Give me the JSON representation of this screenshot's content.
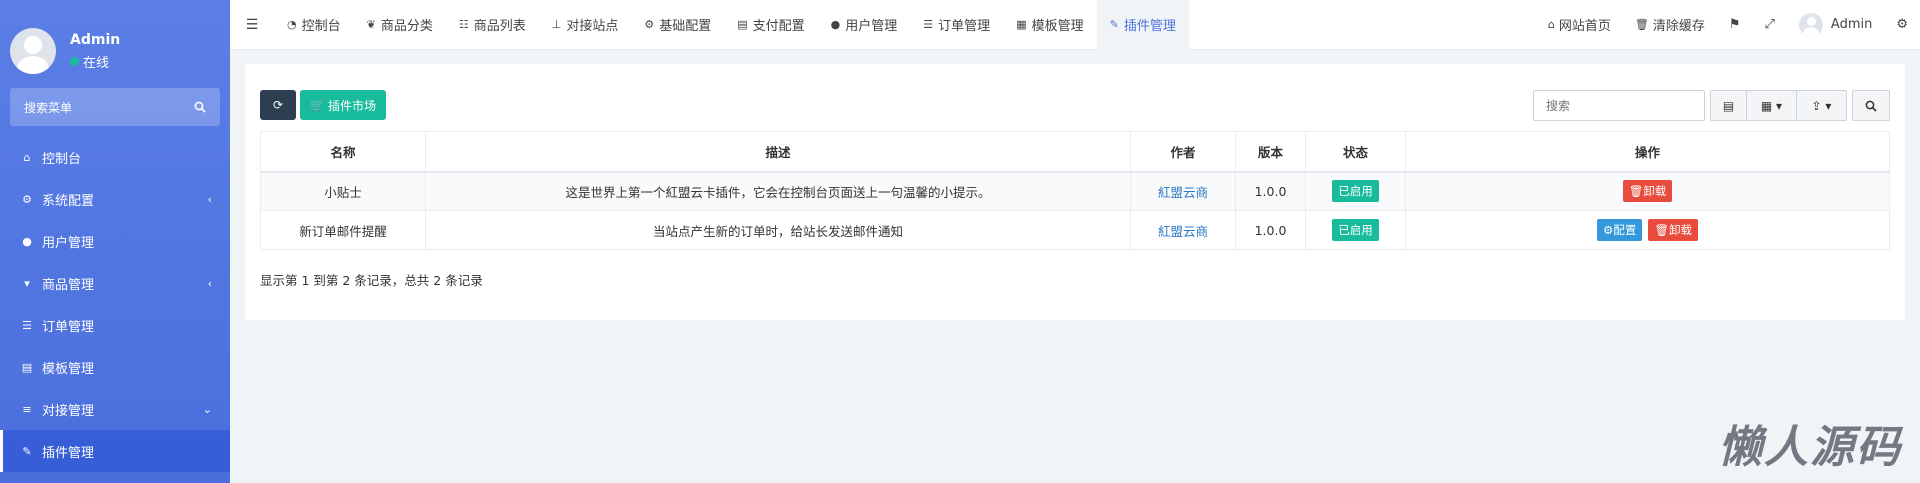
{
  "sidebar": {
    "user": {
      "name": "Admin",
      "status": "在线"
    },
    "search_label": "搜索菜单",
    "items": [
      {
        "label": "控制台",
        "icon": "dashboard-icon",
        "glyph": "⌂"
      },
      {
        "label": "系统配置",
        "icon": "gear-icon",
        "glyph": "⚙"
      },
      {
        "label": "用户管理",
        "icon": "user-icon",
        "glyph": "●"
      },
      {
        "label": "商品管理",
        "icon": "cart-icon",
        "glyph": "🛒"
      },
      {
        "label": "订单管理",
        "icon": "list-icon",
        "glyph": "☰"
      },
      {
        "label": "模板管理",
        "icon": "template-icon",
        "glyph": "▤"
      },
      {
        "label": "对接管理",
        "icon": "sliders-icon",
        "glyph": "≡"
      },
      {
        "label": "插件管理",
        "icon": "plug-icon",
        "glyph": "✎"
      }
    ]
  },
  "topnav": {
    "tabs": [
      {
        "label": "控制台",
        "icon": "dashboard-icon"
      },
      {
        "label": "商品分类",
        "icon": "leaf-icon"
      },
      {
        "label": "商品列表",
        "icon": "list-icon"
      },
      {
        "label": "对接站点",
        "icon": "sitemap-icon"
      },
      {
        "label": "基础配置",
        "icon": "gear-icon"
      },
      {
        "label": "支付配置",
        "icon": "server-icon"
      },
      {
        "label": "用户管理",
        "icon": "user-icon"
      },
      {
        "label": "订单管理",
        "icon": "list-icon"
      },
      {
        "label": "模板管理",
        "icon": "template-icon"
      },
      {
        "label": "插件管理",
        "icon": "plug-icon"
      }
    ],
    "home_label": "网站首页",
    "clear_cache_label": "清除缓存",
    "admin_label": "Admin"
  },
  "toolbar": {
    "market_label": "插件市场",
    "search_placeholder": "搜索"
  },
  "table": {
    "headers": [
      "名称",
      "描述",
      "作者",
      "版本",
      "状态",
      "操作"
    ],
    "rows": [
      {
        "name": "小贴士",
        "desc": "这是世界上第一个紅盟云卡插件，它会在控制台页面送上一句温馨的小提示。",
        "author": "紅盟云商",
        "version": "1.0.0",
        "status": "已启用",
        "config": "",
        "uninstall": "卸载"
      },
      {
        "name": "新订单邮件提醒",
        "desc": "当站点产生新的订单时，给站长发送邮件通知",
        "author": "紅盟云商",
        "version": "1.0.0",
        "status": "已启用",
        "config": "配置",
        "uninstall": "卸载"
      }
    ],
    "summary": "显示第 1 到第 2 条记录，总共 2 条记录"
  },
  "watermark": "懒人源码",
  "colors": {
    "sidebar": "#4e73df",
    "active_tab_text": "#4e73df",
    "green": "#18bc9c",
    "red": "#e74c3c",
    "blue": "#3498db",
    "dark": "#2c3e50"
  }
}
